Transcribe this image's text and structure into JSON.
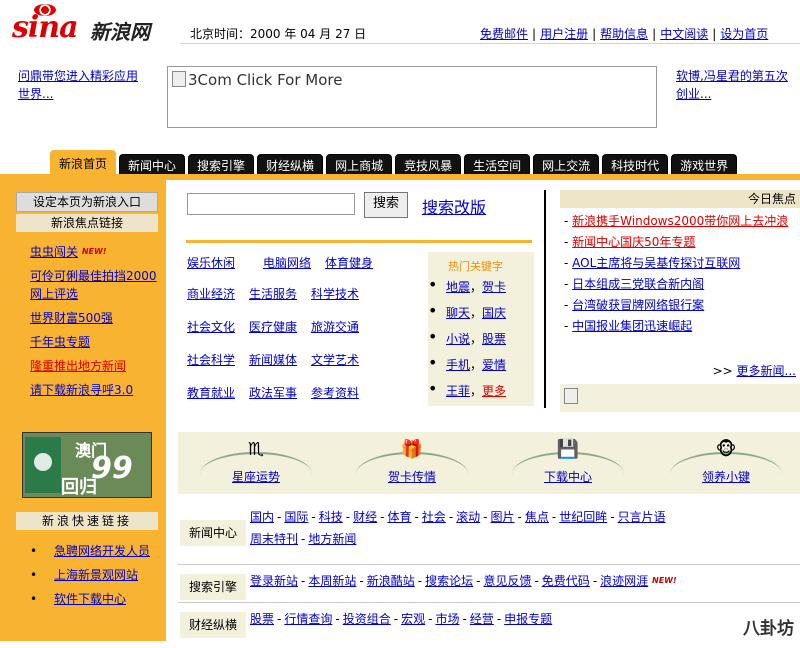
{
  "header": {
    "logo_text": "sina",
    "logo_cn": "新浪网",
    "beijing_time": "北京时间：2000 年 04 月 27 日",
    "top_links": [
      "免费邮件",
      "用户注册",
      "帮助信息",
      "中文阅读",
      "设为首页"
    ]
  },
  "ads": {
    "left": "问鼎带您进入精彩应用世界...",
    "banner": "3Com Click For More",
    "right_line1": "软博,冯星君的第五次",
    "right_line2": "创业..."
  },
  "tabs": [
    "新浪首页",
    "新闻中心",
    "搜索引擎",
    "财经纵横",
    "网上商城",
    "竞技风暴",
    "生活空间",
    "网上交流",
    "科技时代",
    "游戏世界"
  ],
  "left": {
    "set_home": "设定本页为新浪入口",
    "focus_label": "新浪焦点链接",
    "focus_links": [
      "虫虫闯关",
      "可伶可俐最佳拍挡2000网上评选",
      "世界财富500强",
      "千年虫专题",
      "隆重推出地方新闻",
      "请下载新浪寻呼3.0"
    ],
    "new_badge": "NEW!",
    "macau_t1": "澳门",
    "macau_t2": "99",
    "macau_t3": "回归",
    "quick_label": "新浪快速链接",
    "quick_links": [
      "急聘网络开发人员",
      "上海新景观网站",
      "软件下载中心"
    ]
  },
  "search": {
    "button": "搜索",
    "revamp": "搜索改版",
    "value": ""
  },
  "categories": [
    [
      "娱乐休闲",
      "电脑网络",
      "体育健身"
    ],
    [
      "商业经济",
      "生活服务",
      "科学技术"
    ],
    [
      "社会文化",
      "医疗健康",
      "旅游交通"
    ],
    [
      "社会科学",
      "新闻媒体",
      "文学艺术"
    ],
    [
      "教育就业",
      "政法军事",
      "参考资料"
    ]
  ],
  "hot": {
    "title": "热门关键字",
    "rows": [
      [
        "地震",
        "，",
        "贺卡"
      ],
      [
        "聊天",
        "，",
        "国庆"
      ],
      [
        "小说",
        "，",
        "股票"
      ],
      [
        "手机",
        "，",
        "爱情"
      ],
      [
        "王菲",
        "，",
        "更多"
      ]
    ]
  },
  "focus": {
    "title": "今日焦点",
    "items": [
      "新浪携手Windows2000带你网上去冲浪",
      "新闻中心国庆50年专题",
      "AOL主席将与吴基传探讨互联网",
      "日本组成三党联合新内阁",
      "台湾破获冒牌网络银行案",
      "中国报业集团迅速崛起"
    ],
    "more": "更多新闻...",
    "more_prefix": ">>"
  },
  "icons": [
    {
      "symbol": "♏",
      "label": "星座运势"
    },
    {
      "symbol": "🎁",
      "label": "贺卡传情"
    },
    {
      "symbol": "💾",
      "label": "下载中心"
    },
    {
      "symbol": "🐵",
      "label": "领养小键"
    }
  ],
  "rows": [
    {
      "label": "新闻中心",
      "items": [
        "国内",
        "国际",
        "科技",
        "财经",
        "体育",
        "社会",
        "滚动",
        "图片",
        "焦点",
        "世纪回眸",
        "只言片语",
        "周末特刊",
        "地方新闻"
      ]
    },
    {
      "label": "搜索引擎",
      "items": [
        "登录新站",
        "本周新站",
        "新浪酷站",
        "搜索论坛",
        "意见反馈",
        "免费代码",
        "浪迹网涯"
      ]
    },
    {
      "label": "财经纵横",
      "items": [
        "股票",
        "行情查询",
        "投资组合",
        "宏观",
        "市场",
        "经营",
        "申报专题"
      ]
    }
  ],
  "watermark": "八卦坊"
}
